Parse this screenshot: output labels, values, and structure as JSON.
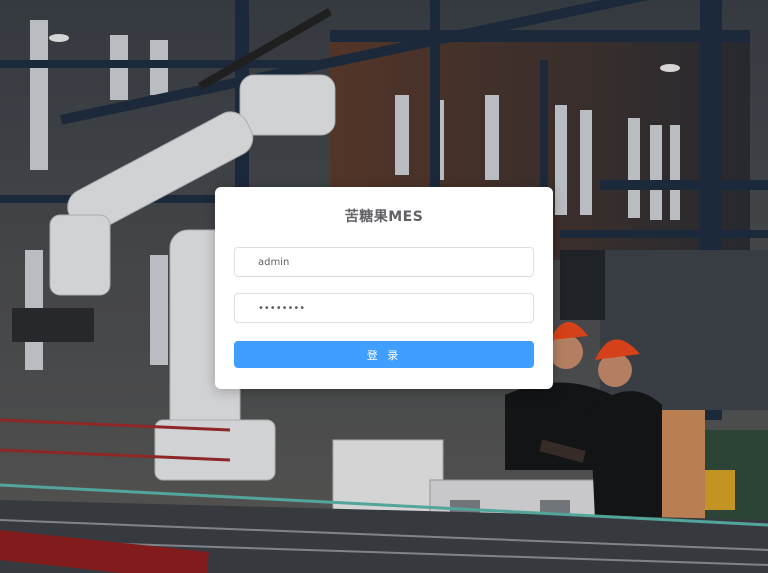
{
  "login": {
    "title": "苦糖果MES",
    "username_value": "admin",
    "password_value": "12345678",
    "submit_label": "登 录"
  },
  "colors": {
    "primary": "#409eff",
    "helmet": "#e8471c",
    "card_bg": "#ffffff"
  }
}
